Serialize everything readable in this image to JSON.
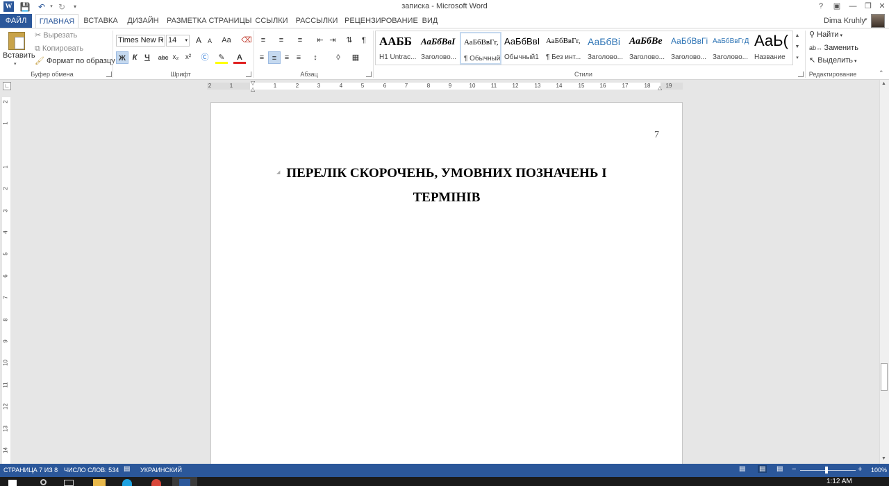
{
  "window": {
    "title": "записка - Microsoft Word",
    "user": "Dima Kruhly",
    "help": "?"
  },
  "tabs": [
    "ФАЙЛ",
    "ГЛАВНАЯ",
    "ВСТАВКА",
    "ДИЗАЙН",
    "РАЗМЕТКА СТРАНИЦЫ",
    "ССЫЛКИ",
    "РАССЫЛКИ",
    "РЕЦЕНЗИРОВАНИЕ",
    "ВИД"
  ],
  "clipboard": {
    "paste": "Вставить",
    "cut": "Вырезать",
    "copy": "Копировать",
    "format_painter": "Формат по образцу",
    "label": "Буфер обмена"
  },
  "font": {
    "name": "Times New R",
    "size": "14",
    "label": "Шрифт",
    "bold": "Ж",
    "italic": "К",
    "underline": "Ч",
    "strike": "abc",
    "sub": "x₂",
    "sup": "x²",
    "grow": "A",
    "shrink": "A",
    "case": "Aa",
    "text_color": "A"
  },
  "paragraph": {
    "label": "Абзац",
    "pilcrow": "¶"
  },
  "styles": {
    "label": "Стили",
    "items": [
      {
        "preview": "ААББ",
        "name": "H1 Untrac..."
      },
      {
        "preview": "АаБбВвІ",
        "name": "Заголово..."
      },
      {
        "preview": "АаБбВвГг,",
        "name": "¶ Обычный"
      },
      {
        "preview": "АаБбВвІ",
        "name": "Обычный1"
      },
      {
        "preview": "АаБбВвГг,",
        "name": "¶ Без инт..."
      },
      {
        "preview": "АаБбВі",
        "name": "Заголово..."
      },
      {
        "preview": "АаБбВе",
        "name": "Заголово..."
      },
      {
        "preview": "АаБбВвГі",
        "name": "Заголово..."
      },
      {
        "preview": "АаБбВвГгД",
        "name": "Заголово..."
      },
      {
        "preview": "АаЬ(",
        "name": "Название"
      }
    ]
  },
  "editing": {
    "label": "Редактирование",
    "find": "Найти",
    "replace": "Заменить",
    "select": "Выделить"
  },
  "ruler": {
    "h": [
      "2",
      "1",
      "1",
      "2",
      "3",
      "4",
      "5",
      "6",
      "7",
      "8",
      "9",
      "10",
      "11",
      "12",
      "13",
      "14",
      "15",
      "16",
      "17",
      "18",
      "19"
    ],
    "v": [
      "2",
      "1",
      "1",
      "2",
      "3",
      "4",
      "5",
      "6",
      "7",
      "8",
      "9",
      "10",
      "11",
      "12",
      "13",
      "14"
    ]
  },
  "document": {
    "page_number": "7",
    "heading_line1": "ПЕРЕЛІК СКОРОЧЕНЬ, УМОВНИХ ПОЗНАЧЕНЬ І",
    "heading_line2": "ТЕРМІНІВ"
  },
  "status": {
    "page": "СТРАНИЦА 7 ИЗ 8",
    "words": "ЧИСЛО СЛОВ: 534",
    "language": "УКРАИНСКИЙ",
    "zoom": "100%",
    "zoom_minus": "−",
    "zoom_plus": "+"
  },
  "taskbar": {
    "time": "1:12 AM"
  },
  "colors": {
    "accent": "#2b579a"
  }
}
